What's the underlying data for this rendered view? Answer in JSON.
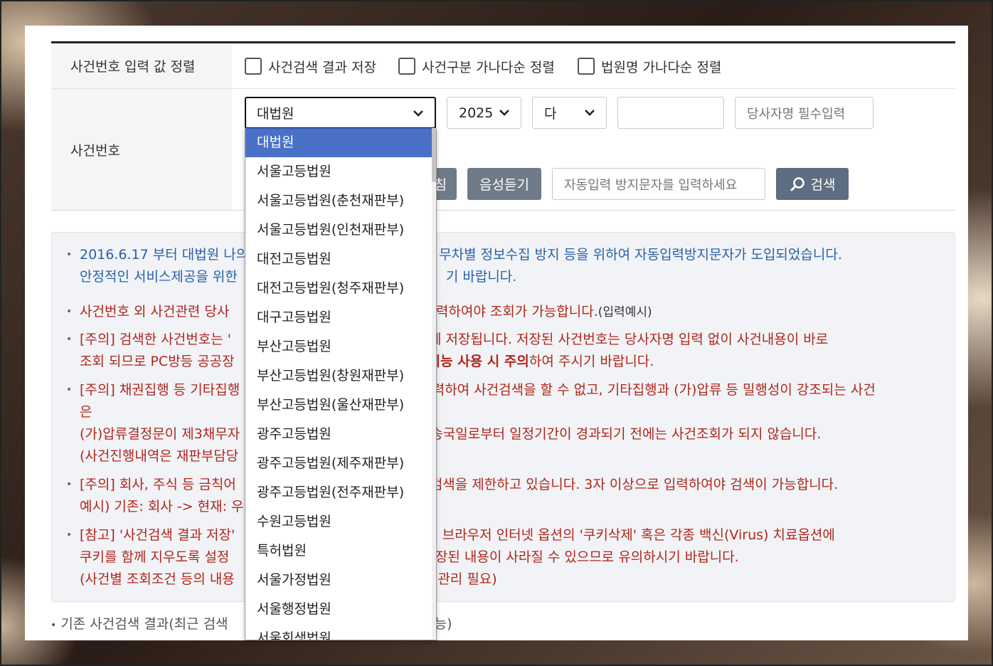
{
  "form": {
    "row1_label": "사건번호 입력 값 정렬",
    "checkboxes": [
      {
        "label": "사건검색 결과 저장",
        "checked": false
      },
      {
        "label": "사건구분 가나다순 정렬",
        "checked": false
      },
      {
        "label": "법원명 가나다순 정렬",
        "checked": false
      }
    ],
    "row2_label": "사건번호",
    "court_value": "대법원",
    "year_value": "2025",
    "type_value": "다",
    "case_number_value": "",
    "party_placeholder": "당사자명 필수입력",
    "refresh_label": "침",
    "voice_label": "음성듣기",
    "captcha_placeholder": "자동입력 방지문자를 입력하세요",
    "search_label": "검색"
  },
  "notice": {
    "line1a": "2016.6.17 부터 대법원 나의",
    "line1b": "무차별 정보수집 방지 등을 위하여 자동입력방지문자가 도입되었습니다.",
    "line1c": "안정적인 서비스제공을 위한",
    "line1d": "기 바랍니다.",
    "line2a": "사건번호 외 사건관련 당사",
    "line2b": "입력하여야 조회가 가능합니다.",
    "line2c": "(입력예시)",
    "line3a": "[주의] 검색한 사건번호는 '",
    "line3b": "에 저장됩니다. 저장된 사건번호는 당사자명 입력 없이 사건내용이 바로",
    "line3c": "조회 되므로 PC방등 공공장",
    "line3d": "기능 사용 시 주의",
    "line3e": "하여 주시기 바랍니다.",
    "line4a": "[주의] 채권집행 등 기타집행",
    "line4b": "입력하여 사건검색을 할 수 없고, 기타집행과 (가)압류 등 밀행성이 강조되는 사건",
    "line4c": "은",
    "line4d": "(가)압류결정문이 제3채무자",
    "line4e": "송국일로부터 일정기간이 경과되기 전에는 사건조회가 되지 않습니다.",
    "line4f": "(사건진행내역은 재판부담당",
    "line5a": "[주의] 회사, 주식 등 금칙어",
    "line5b": "검색을 제한하고 있습니다. 3자 이상으로 입력하여야 검색이 가능합니다.",
    "line5c": "예시) 기존: 회사 -> 현재: 우",
    "line6a": "[참고] '사건검색 결과 저장'",
    "line6b": "웹 브라우저 인터넷 옵션의 '쿠키삭제' 혹은 각종 백신(Virus) 치료옵션에",
    "line6c": "쿠키를 함께 지우도록 설정",
    "line6d": "저장된 내용이 사라질 수 있으므로 유의하시기 바랍니다.",
    "line6e": "(사건별 조회조건 등의 내용",
    "line6f": "로 관리 필요)"
  },
  "footer": {
    "line_a": "기존 사건검색 결과(최근 검색",
    "line_b": "능)"
  },
  "dropdown": {
    "items": [
      "대법원",
      "서울고등법원",
      "서울고등법원(춘천재판부)",
      "서울고등법원(인천재판부)",
      "대전고등법원",
      "대전고등법원(청주재판부)",
      "대구고등법원",
      "부산고등법원",
      "부산고등법원(창원재판부)",
      "부산고등법원(울산재판부)",
      "광주고등법원",
      "광주고등법원(제주재판부)",
      "광주고등법원(전주재판부)",
      "수원고등법원",
      "특허법원",
      "서울가정법원",
      "서울행정법원",
      "서울회생법원"
    ],
    "selected_index": 0
  },
  "colors": {
    "selected_bg": "#4a70c8",
    "notice_blue": "#2a5fa8",
    "notice_red": "#b0261c",
    "button_gray": "#6f7b89"
  }
}
